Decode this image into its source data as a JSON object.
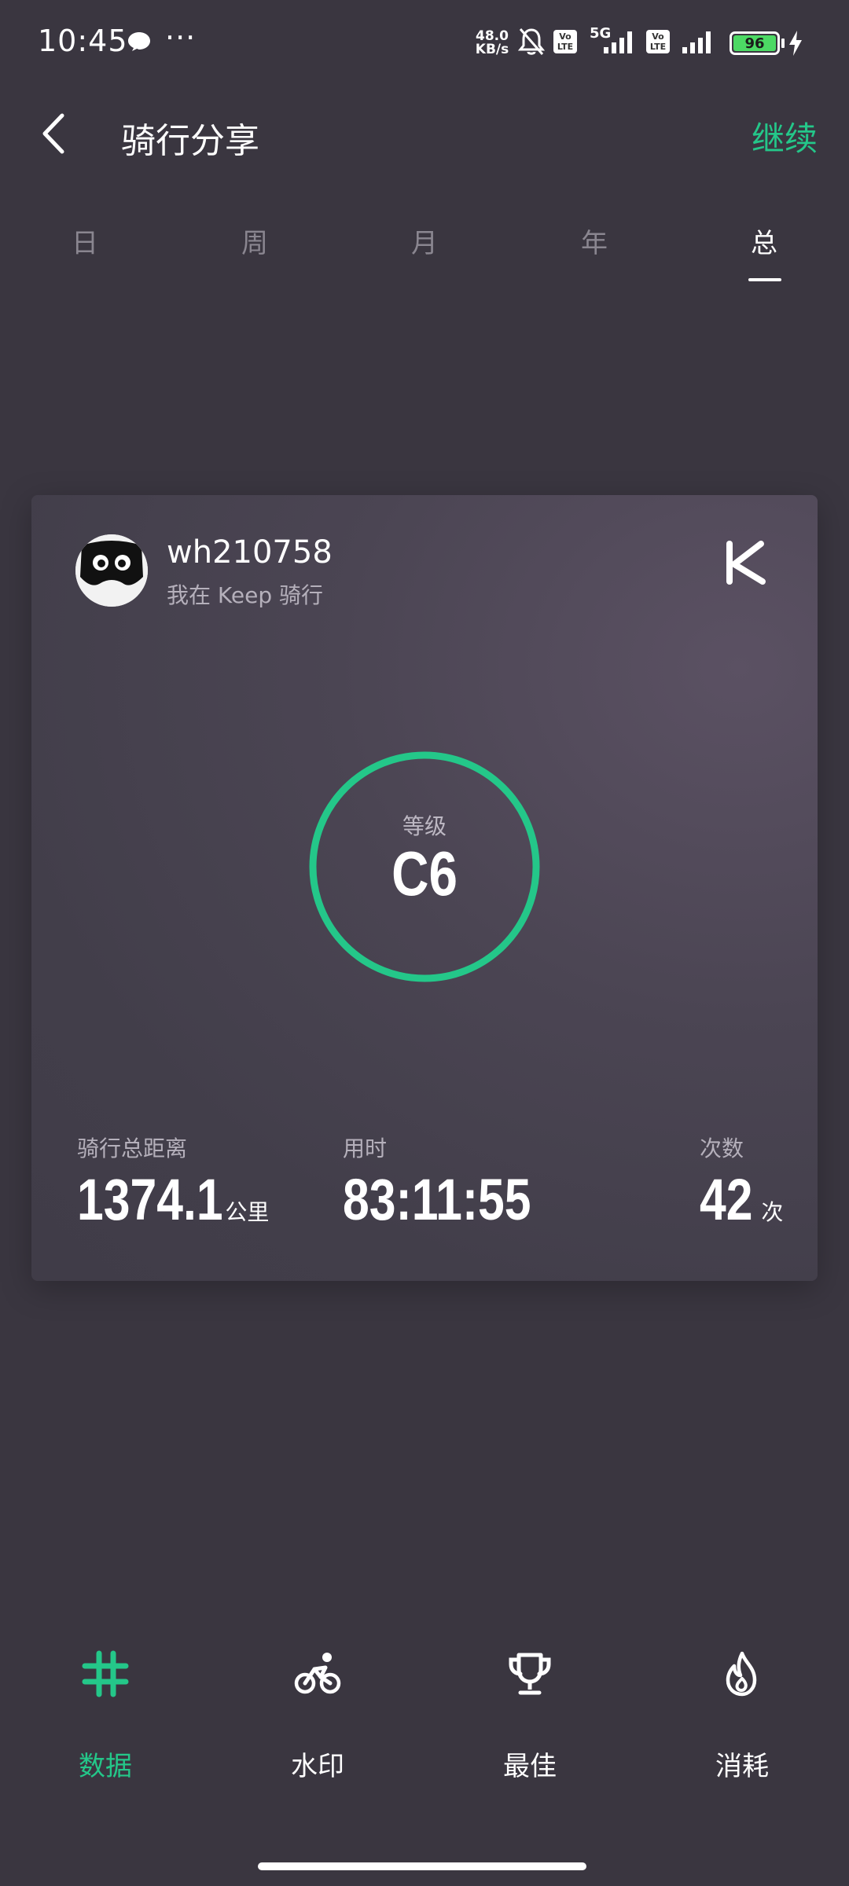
{
  "status_bar": {
    "time": "10:45",
    "dots": "···",
    "net_speed_value": "48.0",
    "net_speed_unit": "KB/s",
    "network_type": "5G",
    "volte_label_1": "Vo LTE",
    "volte_label_2": "Vo LTE",
    "battery": "96",
    "icons": [
      "message-bubble-icon",
      "mute-bell-icon",
      "volte-icon",
      "signal-icon",
      "battery-icon",
      "charging-icon"
    ]
  },
  "header": {
    "title": "骑行分享",
    "continue_label": "继续",
    "back_icon": "chevron-left-icon"
  },
  "tabs": [
    {
      "label": "日",
      "active": false
    },
    {
      "label": "周",
      "active": false
    },
    {
      "label": "月",
      "active": false
    },
    {
      "label": "年",
      "active": false
    },
    {
      "label": "总",
      "active": true
    }
  ],
  "card": {
    "username": "wh210758",
    "subtitle": "我在 Keep 骑行",
    "logo": "keep-logo-icon",
    "level_label": "等级",
    "level_value": "C6",
    "ring_color": "#24c789",
    "stats": [
      {
        "label": "骑行总距离",
        "value": "1374.1",
        "unit": "公里"
      },
      {
        "label": "用时",
        "value": "83:11:55",
        "unit": ""
      },
      {
        "label": "次数",
        "value": "42",
        "unit": "次"
      }
    ]
  },
  "bottom_bar": {
    "items": [
      {
        "label": "数据",
        "icon": "hash-icon",
        "active": true
      },
      {
        "label": "水印",
        "icon": "cyclist-icon",
        "active": false
      },
      {
        "label": "最佳",
        "icon": "trophy-icon",
        "active": false
      },
      {
        "label": "消耗",
        "icon": "flame-icon",
        "active": false
      }
    ]
  },
  "colors": {
    "background": "#3a3640",
    "accent": "#24c789",
    "inactive_tab": "#8a8690"
  }
}
